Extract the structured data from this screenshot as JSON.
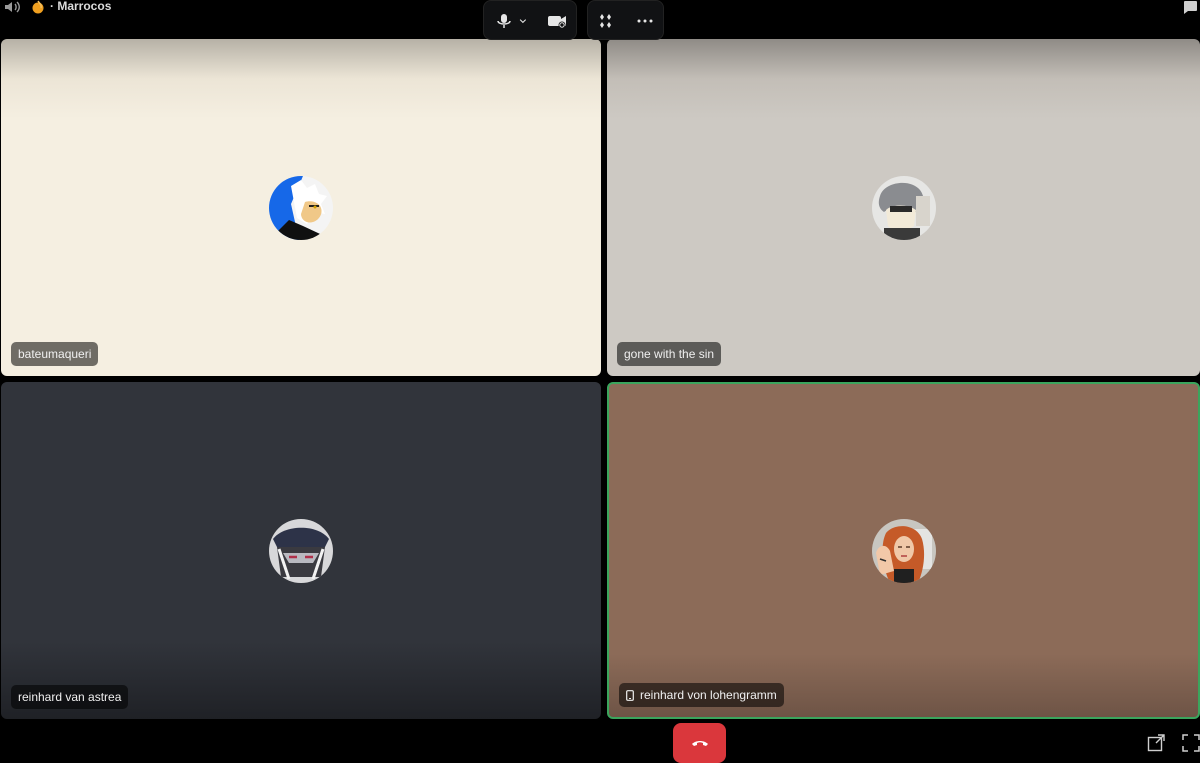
{
  "channel": {
    "name": "Marrocos",
    "separator": "·"
  },
  "participants": [
    {
      "name": "bateumaqueri",
      "avatar": "anime-blonde-avatar",
      "tile_color": "#f5efe1"
    },
    {
      "name": "gone with the sin",
      "avatar": "anime-grey-hair-avatar",
      "tile_color": "#cdc9c3"
    },
    {
      "name": "reinhard van astrea",
      "avatar": "anime-dark-cap-avatar",
      "tile_color": "#31343b"
    },
    {
      "name": "reinhard von lohengramm",
      "avatar": "redhead-photo-avatar",
      "tile_color": "#8c6b58",
      "speaking": true,
      "on_mobile": true
    }
  ],
  "colors": {
    "background": "#000000",
    "end_call": "#da373c",
    "speaking_outline": "#3ba55d"
  },
  "icons": {
    "speaker": "speaker-icon",
    "channel_emoji": "fire-emoji-icon",
    "chat": "chat-bubble-icon",
    "microphone": "microphone-icon",
    "mic_options": "chevron-down-icon",
    "camera": "camera-icon",
    "activities": "activities-icon",
    "more": "more-icon",
    "hang_up": "hang-up-icon",
    "popout": "popout-icon",
    "fullscreen": "fullscreen-icon"
  }
}
